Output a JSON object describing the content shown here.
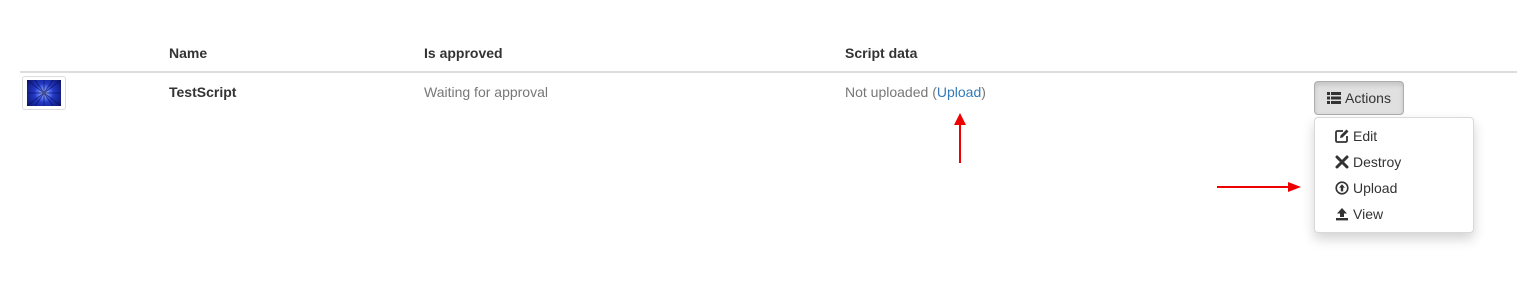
{
  "table": {
    "headers": {
      "name": "Name",
      "is_approved": "Is approved",
      "script_data": "Script data"
    },
    "rows": [
      {
        "name": "TestScript",
        "is_approved": "Waiting for approval",
        "script_status": "Not uploaded",
        "paren_open": "(",
        "upload_link": "Upload",
        "paren_close": ")"
      }
    ]
  },
  "actions": {
    "button_label": "Actions",
    "menu": [
      {
        "label": "Edit",
        "icon": "edit-icon"
      },
      {
        "label": "Destroy",
        "icon": "remove-icon"
      },
      {
        "label": "Upload",
        "icon": "circle-arrow-up-icon"
      },
      {
        "label": "View",
        "icon": "upload-tray-icon"
      }
    ]
  },
  "colors": {
    "link": "#337ab7",
    "annotation_arrow": "#ee0000",
    "muted_text": "#777777"
  }
}
